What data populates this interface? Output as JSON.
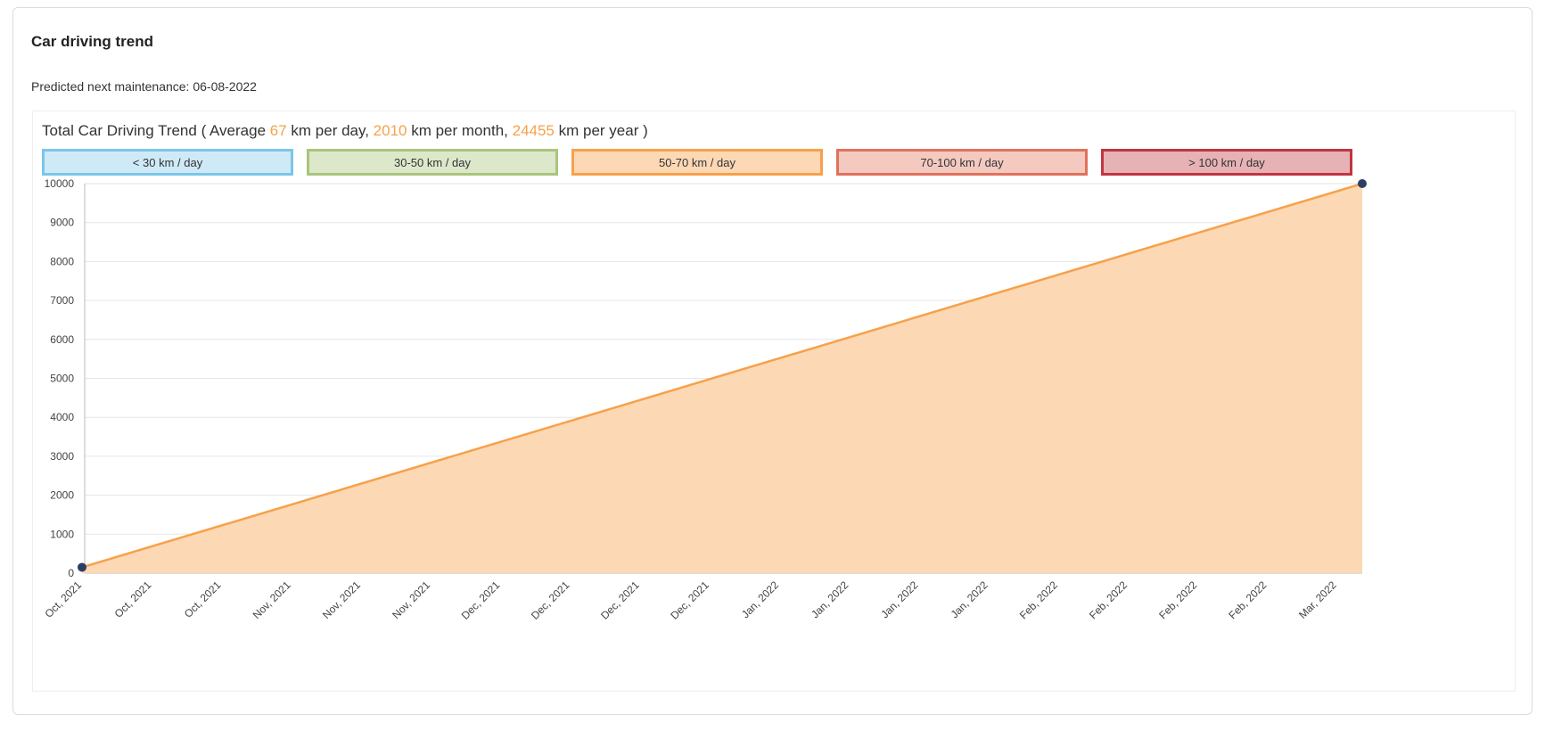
{
  "header": {
    "title": "Car driving trend",
    "maintenance_text": "Predicted next maintenance: 06-08-2022"
  },
  "summary": {
    "prefix": "Total Car Driving Trend ( Average ",
    "per_day": "67",
    "per_day_unit": " km per day, ",
    "per_month": "2010",
    "per_month_unit": " km per month, ",
    "per_year": "24455",
    "per_year_unit": " km per year )"
  },
  "legend": [
    {
      "label": "< 30 km / day",
      "border": "#7cc5e8",
      "fill": "#cfeaf7"
    },
    {
      "label": "30-50 km / day",
      "border": "#a9c57c",
      "fill": "#dde8cb"
    },
    {
      "label": "50-70 km / day",
      "border": "#f7a14a",
      "fill": "#fdd8b5"
    },
    {
      "label": "70-100 km / day",
      "border": "#e0725c",
      "fill": "#f4c9c0"
    },
    {
      "label": "> 100 km / day",
      "border": "#c0363f",
      "fill": "#e7b2b5"
    }
  ],
  "colors": {
    "line": "#f7a14a",
    "area": "#fdd8b5",
    "point": "#2d3e64",
    "grid": "#e6e6e6",
    "highlight": "#f7a14a"
  },
  "chart_data": {
    "type": "area",
    "ylim": [
      0,
      10000
    ],
    "y_ticks": [
      0,
      1000,
      2000,
      3000,
      4000,
      5000,
      6000,
      7000,
      8000,
      9000,
      10000
    ],
    "x_tick_labels": [
      "Oct, 2021",
      "Oct, 2021",
      "Oct, 2021",
      "Nov, 2021",
      "Nov, 2021",
      "Nov, 2021",
      "Dec, 2021",
      "Dec, 2021",
      "Dec, 2021",
      "Dec, 2021",
      "Jan, 2022",
      "Jan, 2022",
      "Jan, 2022",
      "Jan, 2022",
      "Feb, 2022",
      "Feb, 2022",
      "Feb, 2022",
      "Feb, 2022",
      "Mar, 2022"
    ],
    "series": [
      {
        "points": [
          {
            "x": "Oct, 2021",
            "y": 150
          },
          {
            "x": "Mar, 2022",
            "y": 10000
          }
        ]
      }
    ],
    "grid": true
  }
}
